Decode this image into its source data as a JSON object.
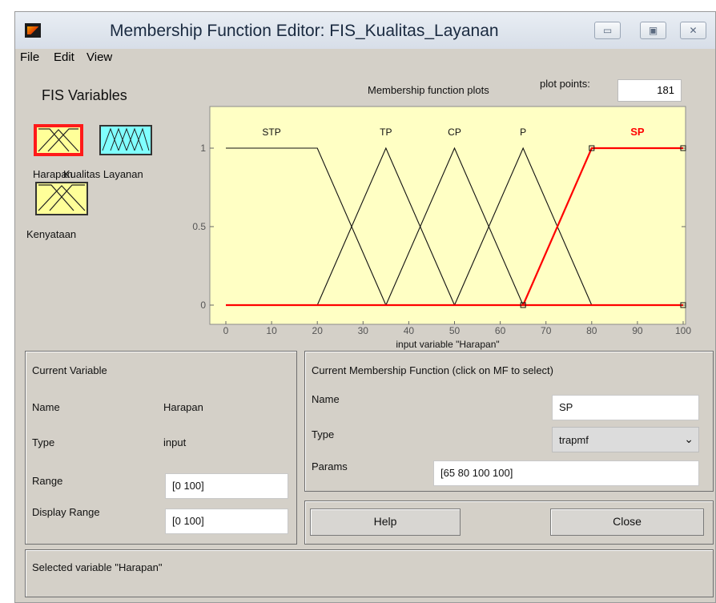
{
  "window": {
    "title": "Membership Function Editor: FIS_Kualitas_Layanan",
    "minimize_glyph": "▭",
    "maximize_glyph": "▣",
    "close_glyph": "✕"
  },
  "menu": [
    "File",
    "Edit",
    "View"
  ],
  "fis_variables": {
    "title": "FIS Variables",
    "inputs": [
      {
        "label": "Harapan",
        "selected": true,
        "color": "#ffff99"
      },
      {
        "label": "Kenyataan",
        "selected": false,
        "color": "#ffff99"
      }
    ],
    "output": {
      "label": "Kualitas Layanan",
      "color": "#80ffff"
    }
  },
  "plot": {
    "title": "Membership function plots",
    "plot_points_label": "plot points:",
    "plot_points_value": "181",
    "xlabel": "input variable \"Harapan\"",
    "x_ticks": [
      "0",
      "10",
      "20",
      "30",
      "40",
      "50",
      "60",
      "70",
      "80",
      "90",
      "100"
    ],
    "y_ticks": [
      "0",
      "0.5",
      "1"
    ],
    "mf_labels": [
      "STP",
      "TP",
      "CP",
      "P",
      "SP"
    ],
    "selected_color": "#ff0000"
  },
  "chart_data": {
    "type": "line",
    "xlabel": "input variable \"Harapan\"",
    "xlim": [
      0,
      100
    ],
    "ylim": [
      0,
      1
    ],
    "series": [
      {
        "name": "STP",
        "x": [
          0,
          20,
          35
        ],
        "y": [
          1,
          1,
          0
        ]
      },
      {
        "name": "TP",
        "x": [
          20,
          35,
          50
        ],
        "y": [
          0,
          1,
          0
        ]
      },
      {
        "name": "CP",
        "x": [
          35,
          50,
          65
        ],
        "y": [
          0,
          1,
          0
        ]
      },
      {
        "name": "P",
        "x": [
          50,
          65,
          80
        ],
        "y": [
          0,
          1,
          0
        ]
      },
      {
        "name": "SP",
        "x": [
          65,
          80,
          100,
          100
        ],
        "y": [
          0,
          1,
          1,
          1
        ]
      }
    ]
  },
  "current_variable": {
    "title": "Current Variable",
    "name_label": "Name",
    "name_value": "Harapan",
    "type_label": "Type",
    "type_value": "input",
    "range_label": "Range",
    "range_value": "[0 100]",
    "display_range_label": "Display Range",
    "display_range_value": "[0 100]"
  },
  "current_mf": {
    "title": "Current Membership Function (click on MF to select)",
    "name_label": "Name",
    "name_value": "SP",
    "type_label": "Type",
    "type_value": "trapmf",
    "params_label": "Params",
    "params_value": "[65 80 100 100]"
  },
  "buttons": {
    "help": "Help",
    "close": "Close"
  },
  "status": "Selected variable \"Harapan\""
}
